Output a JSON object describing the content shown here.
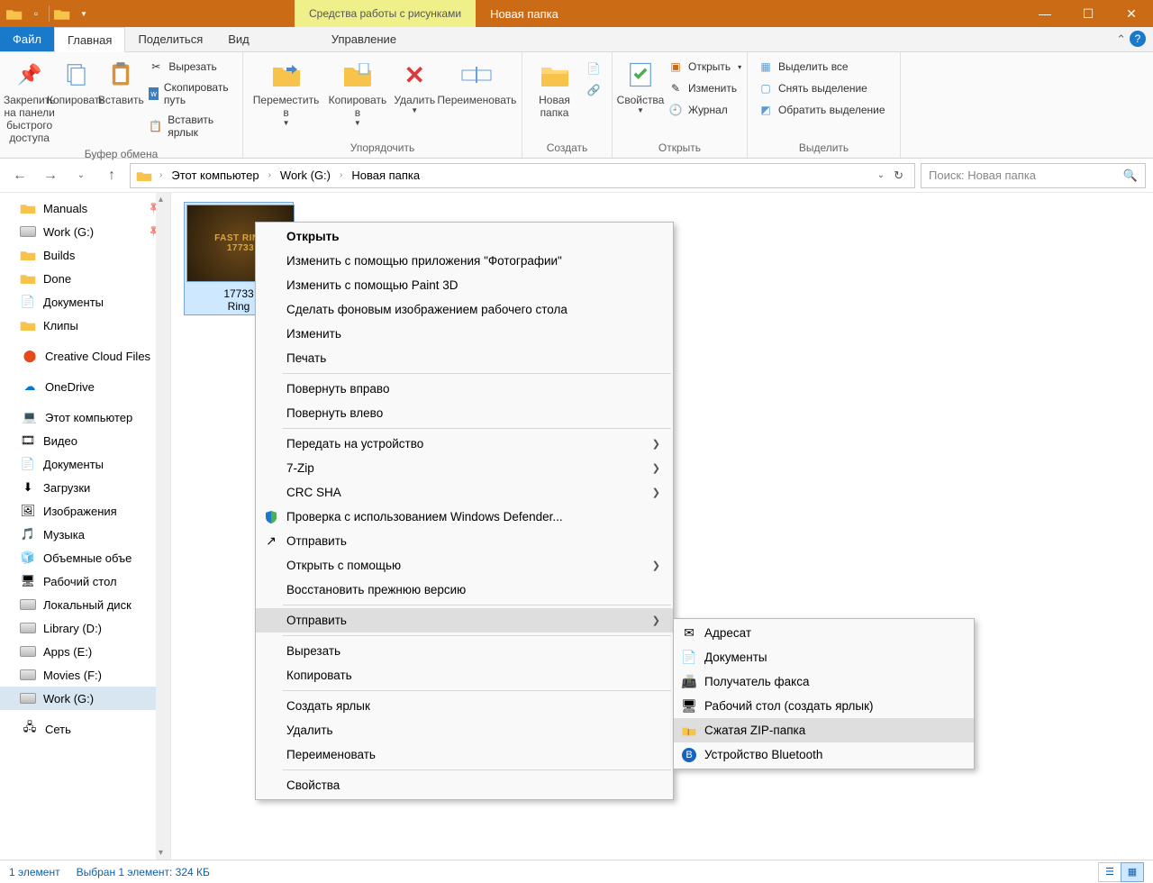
{
  "titlebar": {
    "tools_tab": "Средства работы с рисунками",
    "title": "Новая папка"
  },
  "ribbon_tabs": {
    "file": "Файл",
    "home": "Главная",
    "share": "Поделиться",
    "view": "Вид",
    "manage": "Управление"
  },
  "ribbon": {
    "pin": "Закрепить на панели быстрого доступа",
    "copy": "Копировать",
    "paste": "Вставить",
    "cut": "Вырезать",
    "copy_path": "Скопировать путь",
    "paste_shortcut": "Вставить ярлык",
    "clipboard": "Буфер обмена",
    "move_to": "Переместить в",
    "copy_to": "Копировать в",
    "delete": "Удалить",
    "rename": "Переименовать",
    "organize": "Упорядочить",
    "new_folder": "Новая папка",
    "create": "Создать",
    "properties": "Свойства",
    "open": "Открыть",
    "edit": "Изменить",
    "history": "Журнал",
    "open_group": "Открыть",
    "select_all": "Выделить все",
    "deselect": "Снять выделение",
    "invert_sel": "Обратить выделение",
    "select_group": "Выделить"
  },
  "breadcrumbs": {
    "this_pc": "Этот компьютер",
    "drive": "Work (G:)",
    "folder": "Новая папка"
  },
  "search": {
    "placeholder": "Поиск: Новая папка"
  },
  "nav": {
    "manuals": "Manuals",
    "work": "Work (G:)",
    "builds": "Builds",
    "done": "Done",
    "documents": "Документы",
    "clips": "Клипы",
    "creative": "Creative Cloud Files",
    "onedrive": "OneDrive",
    "this_pc": "Этот компьютер",
    "video": "Видео",
    "docs": "Документы",
    "downloads": "Загрузки",
    "images": "Изображения",
    "music": "Музыка",
    "objects3d": "Объемные объе",
    "desktop": "Рабочий стол",
    "local_disk": "Локальный диск",
    "library_d": "Library (D:)",
    "apps_e": "Apps (E:)",
    "movies_f": "Movies (F:)",
    "work_g": "Work (G:)",
    "network": "Сеть"
  },
  "file": {
    "name_line1": "17733",
    "name_line2": "Ring"
  },
  "context_menu": {
    "open": "Открыть",
    "edit_photos": "Изменить с помощью приложения \"Фотографии\"",
    "edit_paint3d": "Изменить с помощью Paint 3D",
    "set_wallpaper": "Сделать фоновым изображением рабочего стола",
    "edit": "Изменить",
    "print": "Печать",
    "rotate_right": "Повернуть вправо",
    "rotate_left": "Повернуть влево",
    "cast": "Передать на устройство",
    "zip7": "7-Zip",
    "crc": "CRC SHA",
    "defender": "Проверка с использованием Windows Defender...",
    "share": "Отправить",
    "open_with": "Открыть с помощью",
    "restore": "Восстановить прежнюю версию",
    "send_to": "Отправить",
    "cut": "Вырезать",
    "copy": "Копировать",
    "shortcut": "Создать ярлык",
    "delete": "Удалить",
    "rename": "Переименовать",
    "properties": "Свойства"
  },
  "submenu": {
    "recipient": "Адресат",
    "documents": "Документы",
    "fax": "Получатель факса",
    "desktop": "Рабочий стол (создать ярлык)",
    "zip": "Сжатая ZIP-папка",
    "bluetooth": "Устройство Bluetooth"
  },
  "status": {
    "items": "1 элемент",
    "selected": "Выбран 1 элемент: 324 КБ"
  }
}
